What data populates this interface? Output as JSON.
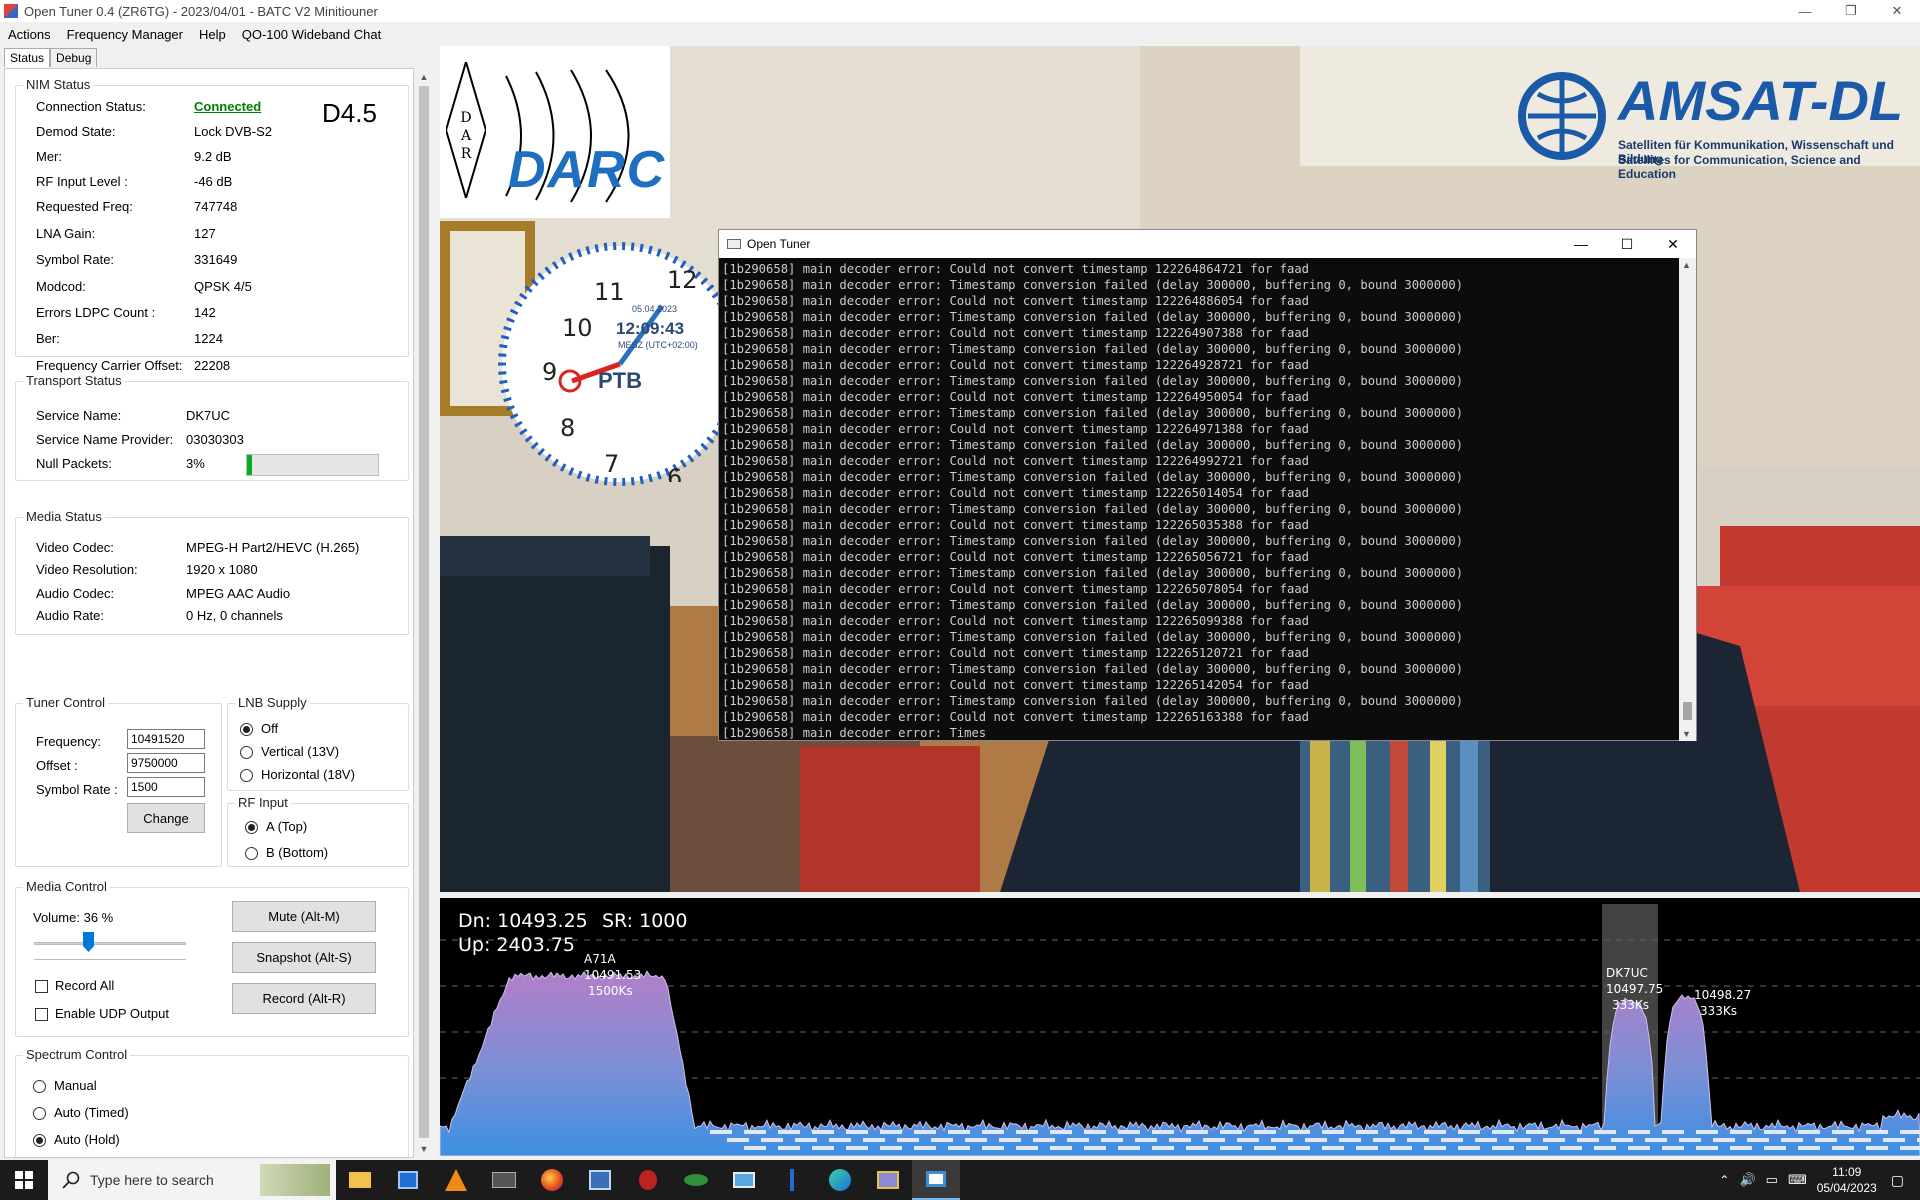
{
  "window": {
    "title": "Open Tuner 0.4 (ZR6TG) - 2023/04/01 - BATC V2 Minitiouner"
  },
  "menu": [
    "Actions",
    "Frequency Manager",
    "Help",
    "QO-100 Wideband Chat"
  ],
  "tabs": [
    "Status",
    "Debug"
  ],
  "nim": {
    "title": "NIM Status",
    "version": "D4.5",
    "rows": [
      {
        "label": "Connection Status:",
        "value": "Connected"
      },
      {
        "label": "Demod State:",
        "value": "Lock DVB-S2"
      },
      {
        "label": "Mer:",
        "value": "9.2 dB"
      },
      {
        "label": "RF Input Level :",
        "value": "-46 dB"
      },
      {
        "label": "Requested Freq:",
        "value": "747748"
      },
      {
        "label": "LNA Gain:",
        "value": "127"
      },
      {
        "label": "Symbol Rate:",
        "value": "331649"
      },
      {
        "label": "Modcod:",
        "value": "QPSK 4/5"
      },
      {
        "label": "Errors LDPC Count :",
        "value": "142"
      },
      {
        "label": "Ber:",
        "value": "1224"
      },
      {
        "label": "Frequency Carrier Offset:",
        "value": "22208"
      }
    ]
  },
  "transport": {
    "title": "Transport Status",
    "service_name_label": "Service Name:",
    "service_name": "DK7UC",
    "provider_label": "Service Name Provider:",
    "provider": "03030303",
    "null_label": "Null Packets:",
    "null_value": "3%",
    "null_fraction": 0.03
  },
  "media": {
    "title": "Media Status",
    "rows": [
      {
        "label": "Video Codec:",
        "value": "MPEG-H Part2/HEVC (H.265)"
      },
      {
        "label": "Video Resolution:",
        "value": "1920 x 1080"
      },
      {
        "label": "Audio Codec:",
        "value": "MPEG AAC Audio"
      },
      {
        "label": "Audio Rate:",
        "value": "0 Hz, 0 channels"
      }
    ]
  },
  "tuner": {
    "title": "Tuner Control",
    "frequency_label": "Frequency:",
    "frequency": "10491520",
    "offset_label": "Offset :",
    "offset": "9750000",
    "symbol_label": "Symbol Rate :",
    "symbol": "1500",
    "change": "Change"
  },
  "lnb": {
    "title": "LNB Supply",
    "options": [
      "Off",
      "Vertical (13V)",
      "Horizontal (18V)"
    ],
    "selected": "Off"
  },
  "rfinput": {
    "title": "RF Input",
    "options": [
      "A (Top)",
      "B (Bottom)"
    ],
    "selected": "A (Top)"
  },
  "mediacontrol": {
    "title": "Media Control",
    "volume_label": "Volume: 36 %",
    "volume": 36,
    "record_all": "Record All",
    "enable_udp": "Enable UDP Output",
    "mute": "Mute (Alt-M)",
    "snapshot": "Snapshot (Alt-S)",
    "record": "Record (Alt-R)"
  },
  "spectrumcontrol": {
    "title": "Spectrum Control",
    "options": [
      "Manual",
      "Auto (Timed)",
      "Auto (Hold)"
    ],
    "selected": "Auto (Hold)"
  },
  "video": {
    "darc": "DARC",
    "amsat": "AMSAT-DL",
    "amsat_line1": "Satelliten für Kommunikation, Wissenschaft und Bildung",
    "amsat_line2": "Satellites for Communication, Science and Education",
    "clock_time": "12:09:43",
    "clock_date": "05.04.2023",
    "clock_zone": "MESZ (UTC+02:00)",
    "clock_brand": "PTB"
  },
  "console": {
    "title": "Open Tuner",
    "lines": [
      "[1b290658] main decoder error: Could not convert timestamp 122264864721 for faad",
      "[1b290658] main decoder error: Timestamp conversion failed (delay 300000, buffering 0, bound 3000000)",
      "[1b290658] main decoder error: Could not convert timestamp 122264886054 for faad",
      "[1b290658] main decoder error: Timestamp conversion failed (delay 300000, buffering 0, bound 3000000)",
      "[1b290658] main decoder error: Could not convert timestamp 122264907388 for faad",
      "[1b290658] main decoder error: Timestamp conversion failed (delay 300000, buffering 0, bound 3000000)",
      "[1b290658] main decoder error: Could not convert timestamp 122264928721 for faad",
      "[1b290658] main decoder error: Timestamp conversion failed (delay 300000, buffering 0, bound 3000000)",
      "[1b290658] main decoder error: Could not convert timestamp 122264950054 for faad",
      "[1b290658] main decoder error: Timestamp conversion failed (delay 300000, buffering 0, bound 3000000)",
      "[1b290658] main decoder error: Could not convert timestamp 122264971388 for faad",
      "[1b290658] main decoder error: Timestamp conversion failed (delay 300000, buffering 0, bound 3000000)",
      "[1b290658] main decoder error: Could not convert timestamp 122264992721 for faad",
      "[1b290658] main decoder error: Timestamp conversion failed (delay 300000, buffering 0, bound 3000000)",
      "[1b290658] main decoder error: Could not convert timestamp 122265014054 for faad",
      "[1b290658] main decoder error: Timestamp conversion failed (delay 300000, buffering 0, bound 3000000)",
      "[1b290658] main decoder error: Could not convert timestamp 122265035388 for faad",
      "[1b290658] main decoder error: Timestamp conversion failed (delay 300000, buffering 0, bound 3000000)",
      "[1b290658] main decoder error: Could not convert timestamp 122265056721 for faad",
      "[1b290658] main decoder error: Timestamp conversion failed (delay 300000, buffering 0, bound 3000000)",
      "[1b290658] main decoder error: Could not convert timestamp 122265078054 for faad",
      "[1b290658] main decoder error: Timestamp conversion failed (delay 300000, buffering 0, bound 3000000)",
      "[1b290658] main decoder error: Could not convert timestamp 122265099388 for faad",
      "[1b290658] main decoder error: Timestamp conversion failed (delay 300000, buffering 0, bound 3000000)",
      "[1b290658] main decoder error: Could not convert timestamp 122265120721 for faad",
      "[1b290658] main decoder error: Timestamp conversion failed (delay 300000, buffering 0, bound 3000000)",
      "[1b290658] main decoder error: Could not convert timestamp 122265142054 for faad",
      "[1b290658] main decoder error: Timestamp conversion failed (delay 300000, buffering 0, bound 3000000)",
      "[1b290658] main decoder error: Could not convert timestamp 122265163388 for faad",
      "[1b290658] main decoder error: Times"
    ]
  },
  "spectrum": {
    "dn": "Dn: 10493.25",
    "sr": "SR: 1000",
    "up": "Up: 2403.75",
    "signals": [
      {
        "callsign": "A71A",
        "freq": "10491.53",
        "sr": "1500Ks"
      },
      {
        "callsign": "DK7UC",
        "freq": "10497.75",
        "sr": "333Ks"
      },
      {
        "callsign": "",
        "freq": "10498.27",
        "sr": "333Ks"
      }
    ]
  },
  "taskbar": {
    "search_placeholder": "Type here to search",
    "time": "11:09",
    "date": "05/04/2023"
  },
  "colors": {
    "connected": "#008000",
    "spectrum_top": "#b07cc6",
    "spectrum_bottom": "#3d8fe0"
  }
}
